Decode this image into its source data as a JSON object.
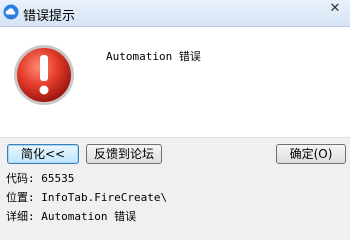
{
  "window": {
    "title": "错误提示",
    "close_glyph": "✕"
  },
  "message": {
    "text": "Automation 错误"
  },
  "buttons": {
    "simplify_label": "简化<<",
    "feedback_label": "反馈到论坛",
    "ok_label": "确定(O)"
  },
  "details": {
    "code": "代码: 65535",
    "location": "位置: InfoTab.FireCreate\\",
    "detail": "详细: Automation 错误"
  },
  "colors": {
    "error_red": "#e23b2b",
    "title_bar": "#d6e4f5"
  }
}
